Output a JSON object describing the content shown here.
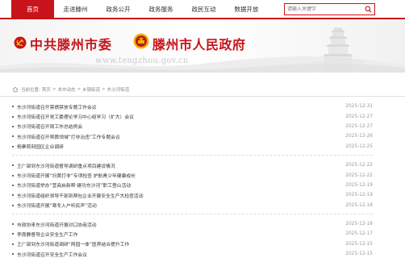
{
  "nav": {
    "items": [
      {
        "label": "首页",
        "active": true
      },
      {
        "label": "走进滕州",
        "active": false
      },
      {
        "label": "政务公开",
        "active": false
      },
      {
        "label": "政务服务",
        "active": false
      },
      {
        "label": "政民互动",
        "active": false
      },
      {
        "label": "数据开放",
        "active": false
      }
    ],
    "search_placeholder": "请输入关键字"
  },
  "banner": {
    "title_party": "中共滕州市委",
    "title_gov": "滕州市人民政府",
    "url": "www.tengzhou.gov.cn"
  },
  "breadcrumb": {
    "prefix": "当前位置:",
    "items": [
      "首页",
      "本市动态",
      "乡镇街道",
      "东沙河街道"
    ]
  },
  "groups": [
    {
      "rows": [
        {
          "title": "东沙河街道召开禁燃禁放专题工作会议",
          "date": "2025-12-31"
        },
        {
          "title": "东沙河街道召开党工委理论学习中心组学习（扩大）会议",
          "date": "2025-12-27"
        },
        {
          "title": "东沙河街道召开周工作总结例会",
          "date": "2025-12-27"
        },
        {
          "title": "东沙河街道召开殡葬领域“打非治违”工作专题会议",
          "date": "2025-12-26"
        },
        {
          "title": "杨寨剪刻园区企业调研",
          "date": "2025-12-25"
        }
      ]
    },
    {
      "rows": [
        {
          "title": "王广部到东沙河街道督导调研重点项目建设情况",
          "date": "2025-12-22"
        },
        {
          "title": "东沙河街道开展“扫黄打非”专项检查 护航青少年健康成长",
          "date": "2025-12-22"
        },
        {
          "title": "东沙河街道举办“营商启新帮·建功东沙河”职工登山活动",
          "date": "2025-12-19"
        },
        {
          "title": "东沙河街道组织领导干部到帮包企业开展安全生产大检查活动",
          "date": "2025-12-19"
        },
        {
          "title": "东沙河街道开展“寒冬入户听民声”活动",
          "date": "2025-12-18"
        }
      ]
    },
    {
      "rows": [
        {
          "title": "市政协来东沙河街道开展对口协商活动",
          "date": "2025-12-18"
        },
        {
          "title": "李席静督导企业安全生产工作",
          "date": "2025-12-17"
        },
        {
          "title": "王广部到东沙河街道调研“两园一体”医养结合提升工作",
          "date": "2025-12-15"
        },
        {
          "title": "东沙河街道召开安全生产工作会议",
          "date": "2025-12-15"
        }
      ]
    }
  ],
  "colors": {
    "accent": "#c8141a",
    "text": "#333333",
    "date": "#999999"
  }
}
